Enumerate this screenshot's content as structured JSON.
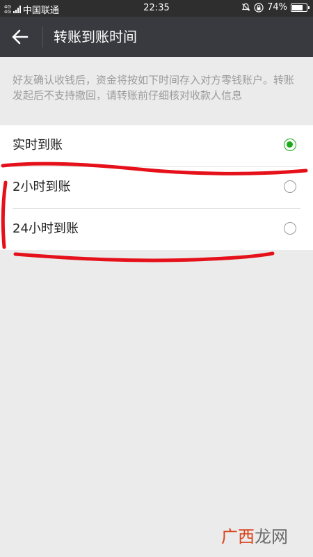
{
  "status_bar": {
    "network": "4G",
    "network2": "4G",
    "carrier": "中国联通",
    "time": "22:35",
    "battery": "74%",
    "battery_level": 0.74
  },
  "app_bar": {
    "back_icon": "arrow-left-icon",
    "title": "转账到账时间"
  },
  "notice": "好友确认收钱后，资金将按如下时间存入对方零钱账户。转账发起后不支持撤回，请转账前仔细核对收款人信息",
  "options": [
    {
      "label": "实时到账",
      "selected": true
    },
    {
      "label": "2小时到账",
      "selected": false
    },
    {
      "label": "24小时到账",
      "selected": false
    }
  ],
  "watermark": {
    "part1": "广西",
    "part2": "龙网"
  },
  "colors": {
    "appbar": "#393a3f",
    "selected": "#1aad19",
    "annotation": "#e5101a"
  }
}
